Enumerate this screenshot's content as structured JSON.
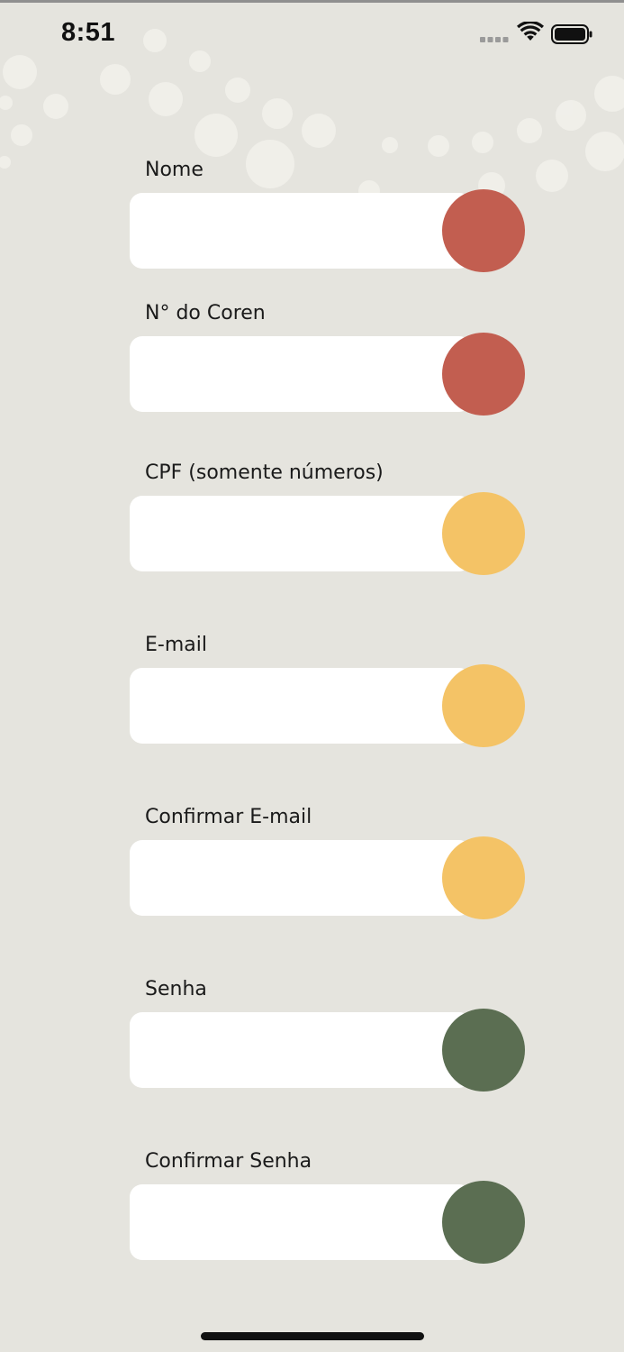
{
  "status_bar": {
    "time": "8:51",
    "icons": [
      "cellular-signal-icon",
      "wifi-icon",
      "battery-icon"
    ]
  },
  "form": {
    "fields": [
      {
        "label": "Nome",
        "value": "",
        "indicator_color": "#c25e50"
      },
      {
        "label": "N° do Coren",
        "value": "",
        "indicator_color": "#c25e50"
      },
      {
        "label": "CPF (somente números)",
        "value": "",
        "indicator_color": "#f4c366"
      },
      {
        "label": "E-mail",
        "value": "",
        "indicator_color": "#f4c366"
      },
      {
        "label": "Confirmar E-mail",
        "value": "",
        "indicator_color": "#f4c366"
      },
      {
        "label": "Senha",
        "value": "",
        "indicator_color": "#5b6e52"
      },
      {
        "label": "Confirmar Senha",
        "value": "",
        "indicator_color": "#5b6e52"
      }
    ]
  },
  "colors": {
    "background": "#e5e4de",
    "input_background": "#ffffff",
    "error": "#c25e50",
    "warning": "#f4c366",
    "ok": "#5b6e52"
  }
}
